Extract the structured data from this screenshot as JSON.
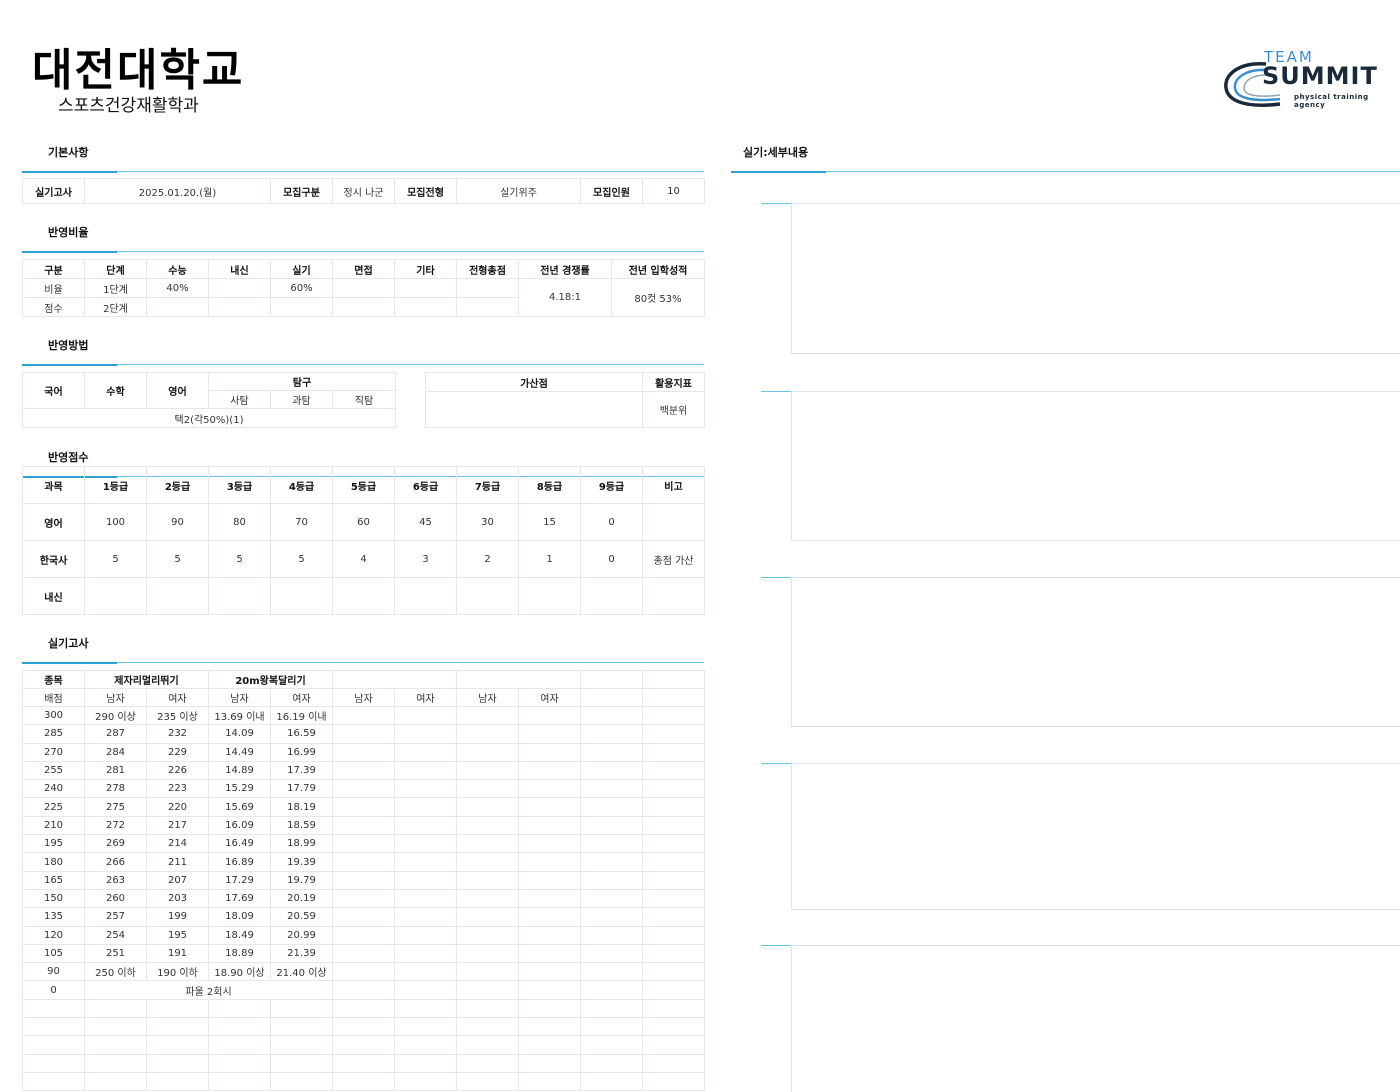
{
  "header": {
    "university": "대전대학교",
    "department": "스포츠건강재활학과"
  },
  "logo": {
    "team": "TEAM",
    "summit": "SUMMIT",
    "tagline": "physical training agency",
    "brand_color": "#3b8fd0"
  },
  "sections": {
    "basic": "기본사항",
    "ratio": "반영비율",
    "method": "반영방법",
    "score": "반영점수",
    "practical": "실기고사",
    "detail": "실기:세부내용"
  },
  "basic": {
    "exam_date_label": "실기고사",
    "exam_date": "2025.01.20.(월)",
    "recruit_type_label": "모집구분",
    "recruit_type": "정시 나군",
    "recruit_method_label": "모집전형",
    "recruit_method": "실기위주",
    "quota_label": "모집인원",
    "quota": "10"
  },
  "ratio": {
    "headers": [
      "구분",
      "단계",
      "수능",
      "내신",
      "실기",
      "면접",
      "기타",
      "전형총점",
      "전년 경쟁률",
      "전년 입학성적"
    ],
    "rows": [
      [
        "비율",
        "1단계",
        "40%",
        "",
        "60%",
        "",
        "",
        ""
      ],
      [
        "점수",
        "2단계",
        "",
        "",
        "",
        "",
        "",
        ""
      ]
    ],
    "prev_competition": "4.18:1",
    "prev_admission": "80컷 53%"
  },
  "method": {
    "korean": "국어",
    "math": "수학",
    "english": "영어",
    "inquiry": "탐구",
    "social": "사탐",
    "science": "과탐",
    "vocational": "직탐",
    "selection": "택2(각50%)(1)",
    "bonus_label": "가산점",
    "bonus_value": "",
    "index_label": "활용지표",
    "index_value": "백분위"
  },
  "score": {
    "headers": [
      "과목",
      "1등급",
      "2등급",
      "3등급",
      "4등급",
      "5등급",
      "6등급",
      "7등급",
      "8등급",
      "9등급",
      "비고"
    ],
    "rows": [
      [
        "영어",
        "100",
        "90",
        "80",
        "70",
        "60",
        "45",
        "30",
        "15",
        "0",
        ""
      ],
      [
        "한국사",
        "5",
        "5",
        "5",
        "5",
        "4",
        "3",
        "2",
        "1",
        "0",
        "총점 가산"
      ],
      [
        "내신",
        "",
        "",
        "",
        "",
        "",
        "",
        "",
        "",
        "",
        ""
      ]
    ]
  },
  "practical": {
    "event_label": "종목",
    "event1": "제자리멀리뛰기",
    "event2": "20m왕복달리기",
    "score_label": "배점",
    "male": "남자",
    "female": "여자",
    "rows": [
      [
        "300",
        "290 이상",
        "235 이상",
        "13.69 이내",
        "16.19 이내"
      ],
      [
        "285",
        "287",
        "232",
        "14.09",
        "16.59"
      ],
      [
        "270",
        "284",
        "229",
        "14.49",
        "16.99"
      ],
      [
        "255",
        "281",
        "226",
        "14.89",
        "17.39"
      ],
      [
        "240",
        "278",
        "223",
        "15.29",
        "17.79"
      ],
      [
        "225",
        "275",
        "220",
        "15.69",
        "18.19"
      ],
      [
        "210",
        "272",
        "217",
        "16.09",
        "18.59"
      ],
      [
        "195",
        "269",
        "214",
        "16.49",
        "18.99"
      ],
      [
        "180",
        "266",
        "211",
        "16.89",
        "19.39"
      ],
      [
        "165",
        "263",
        "207",
        "17.29",
        "19.79"
      ],
      [
        "150",
        "260",
        "203",
        "17.69",
        "20.19"
      ],
      [
        "135",
        "257",
        "199",
        "18.09",
        "20.59"
      ],
      [
        "120",
        "254",
        "195",
        "18.49",
        "20.99"
      ],
      [
        "105",
        "251",
        "191",
        "18.89",
        "21.39"
      ],
      [
        "90",
        "250 이하",
        "190 이하",
        "18.90 이상",
        "21.40 이상"
      ]
    ],
    "zero_score": "0",
    "zero_note": "파울 2회시"
  },
  "colors": {
    "section_line": "#6cc5e6",
    "section_accent": "#2ba3d6",
    "grid_border": "#e3e8ee"
  }
}
